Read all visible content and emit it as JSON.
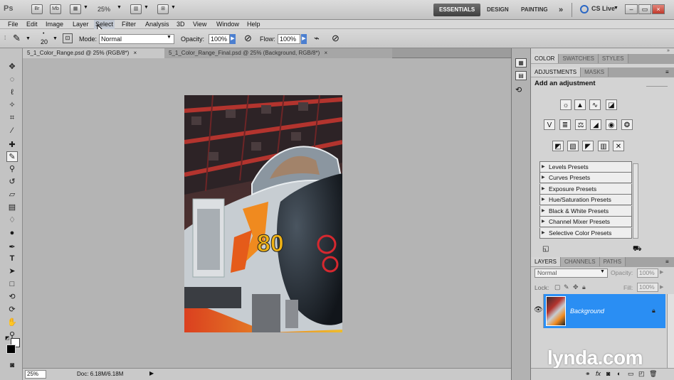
{
  "app": {
    "logo": "Ps",
    "zoom": "25%",
    "workspaces": [
      "ESSENTIALS",
      "DESIGN",
      "PAINTING"
    ],
    "more": "»",
    "cs_live": "CS Live"
  },
  "menu": [
    "File",
    "Edit",
    "Image",
    "Layer",
    "Select",
    "Filter",
    "Analysis",
    "3D",
    "View",
    "Window",
    "Help"
  ],
  "options": {
    "brush_size": "20",
    "mode_label": "Mode:",
    "mode_value": "Normal",
    "opacity_label": "Opacity:",
    "opacity_value": "100%",
    "flow_label": "Flow:",
    "flow_value": "100%"
  },
  "tabs": [
    {
      "label": "5_1_Color_Range.psd @ 25% (RGB/8*)",
      "close": "×"
    },
    {
      "label": "5_1_Color_Range_Final.psd @ 25% (Background, RGB/8*)",
      "close": "×"
    }
  ],
  "status": {
    "zoom": "25%",
    "doc": "Doc: 6.18M/6.18M"
  },
  "panels": {
    "color_tabs": [
      "COLOR",
      "SWATCHES",
      "STYLES"
    ],
    "adj_tabs": [
      "ADJUSTMENTS",
      "MASKS"
    ],
    "adj_heading": "Add an adjustment",
    "presets": [
      "Levels Presets",
      "Curves Presets",
      "Exposure Presets",
      "Hue/Saturation Presets",
      "Black & White Presets",
      "Channel Mixer Presets",
      "Selective Color Presets"
    ],
    "layer_tabs": [
      "LAYERS",
      "CHANNELS",
      "PATHS"
    ],
    "blend_mode": "Normal",
    "opacity_label": "Opacity:",
    "opacity_value": "100%",
    "lock_label": "Lock:",
    "fill_label": "Fill:",
    "fill_value": "100%",
    "layer_name": "Background"
  },
  "watermark": "lynda.com",
  "colors": {
    "layer_selected": "#2a8ef3",
    "panel_bg": "#d3d3d3",
    "canvas_bg": "#b4b4b4"
  }
}
